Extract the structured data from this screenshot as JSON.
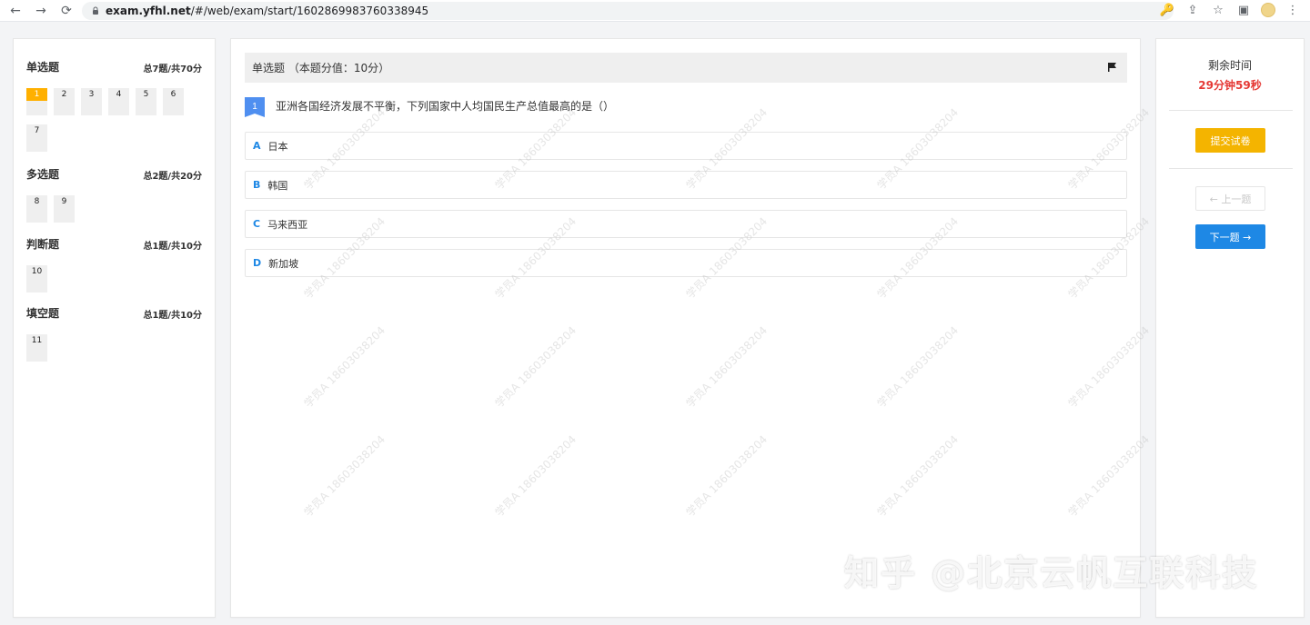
{
  "browser": {
    "url_domain": "exam.yfhl.net",
    "url_path": "/#/web/exam/start/1602869983760338945"
  },
  "sidebar": {
    "sections": [
      {
        "title": "单选题",
        "total": "总7题/共70分",
        "questions": [
          "1",
          "2",
          "3",
          "4",
          "5",
          "6",
          "7"
        ],
        "current": "1"
      },
      {
        "title": "多选题",
        "total": "总2题/共20分",
        "questions": [
          "8",
          "9"
        ]
      },
      {
        "title": "判断题",
        "total": "总1题/共10分",
        "questions": [
          "10"
        ]
      },
      {
        "title": "填空题",
        "total": "总1题/共10分",
        "questions": [
          "11"
        ]
      }
    ]
  },
  "main": {
    "header": "单选题 （本题分值：10分）",
    "question_index": "1",
    "question_text": "亚洲各国经济发展不平衡，下列国家中人均国民生产总值最高的是（）",
    "options": [
      {
        "letter": "A",
        "text": "日本"
      },
      {
        "letter": "B",
        "text": "韩国"
      },
      {
        "letter": "C",
        "text": "马来西亚"
      },
      {
        "letter": "D",
        "text": "新加坡"
      }
    ]
  },
  "right": {
    "timer_label": "剩余时间",
    "timer_value": "29分钟59秒",
    "submit_label": "提交试卷",
    "prev_label": "← 上一题",
    "next_label": "下一题 →"
  },
  "watermark": {
    "text": "学员A 18603038204"
  },
  "brand": {
    "text": "知乎 @北京云帆互联科技"
  },
  "colors": {
    "accent_orange": "#ffb000",
    "primary_blue": "#1e88e5",
    "timer_red": "#e53935"
  }
}
